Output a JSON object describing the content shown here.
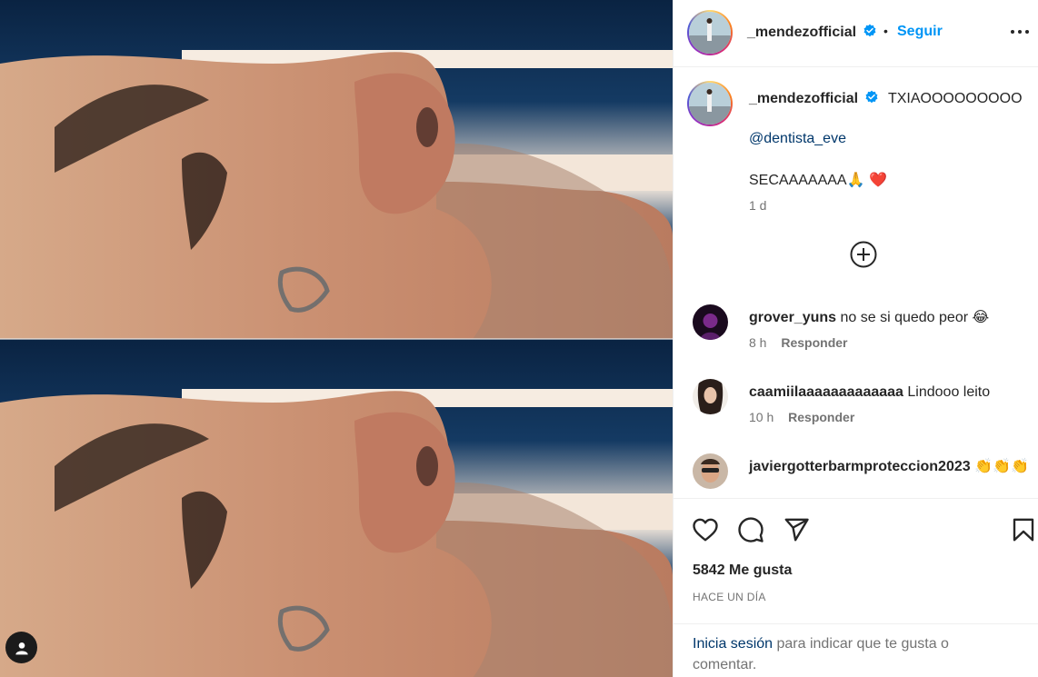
{
  "post": {
    "username": "_mendezofficial",
    "follow_label": "Seguir",
    "separator": "•",
    "caption": "TXIAOOOOOOOOO",
    "mention": "@dentista_eve",
    "caption_extra": "SECAAAAAAA🙏 ❤️",
    "caption_time": "1 d",
    "likes": "5842 Me gusta",
    "date": "HACE UN DÍA"
  },
  "comments": [
    {
      "user": "grover_yuns",
      "text": "no se si quedo peor 😂",
      "time": "8 h",
      "reply": "Responder"
    },
    {
      "user": "caamiilaaaaaaaaaaaaa",
      "text": "Lindooo leito",
      "time": "10 h",
      "reply": "Responder"
    },
    {
      "user": "javiergotterbarmproteccion2023",
      "text": "👏👏👏",
      "time": "",
      "reply": ""
    }
  ],
  "login": {
    "link": "Inicia sesión",
    "text": " para indicar que te gusta o comentar."
  },
  "icons": {
    "more": "more-options-icon",
    "verified": "verified-badge-icon",
    "load_more": "plus-circle-icon",
    "like": "heart-icon",
    "comment": "comment-icon",
    "share": "paper-plane-icon",
    "save": "bookmark-icon",
    "user_tag": "user-icon"
  },
  "colors": {
    "link_blue": "#0095f6",
    "mention_blue": "#00376b",
    "muted": "#737373",
    "text": "#262626"
  }
}
